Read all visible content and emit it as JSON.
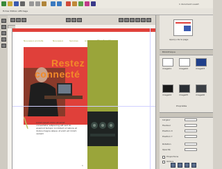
{
  "app": {
    "menu_text": "Fichier  Edition  Affichage",
    "status_text": "1 document ouvert"
  },
  "toolbar": {
    "icons": [
      "new-icon",
      "open-icon",
      "save-icon",
      "print-icon",
      "cut-icon",
      "copy-icon",
      "paste-icon",
      "undo-icon",
      "redo-icon",
      "zoom-icon",
      "text-icon",
      "image-icon",
      "color-icon",
      "layer-icon"
    ]
  },
  "document": {
    "nav_items": [
      "Nouveaux produits",
      "Nouveaux",
      "Services",
      "Accueil",
      "Navigation"
    ],
    "headline_1": "Restez",
    "headline_2": "connecté",
    "body_text": "Lorem ipsum dolor sit amet consectetur adipiscing elit sed do eiusmod tempor incididunt ut labore et dolore magna aliqua ut enim ad minim veniam",
    "page_number": "1"
  },
  "panel": {
    "preview_caption": "Aperçu de la page",
    "section_label": "Bibliothèque",
    "thumbnails": [
      "image01",
      "image02",
      "image03",
      "image04",
      "image05",
      "image06"
    ],
    "option_label": "Propriétés",
    "fields": [
      "Largeur",
      "Hauteur",
      "Position X",
      "Position Y",
      "Rotation",
      "Opacité"
    ],
    "checkbox_1": "Proportions",
    "checkbox_2": "Ombre"
  },
  "colors": {
    "accent_red": "#e0403a",
    "olive": "#9aa53a",
    "title_orange": "#f28a2a"
  }
}
